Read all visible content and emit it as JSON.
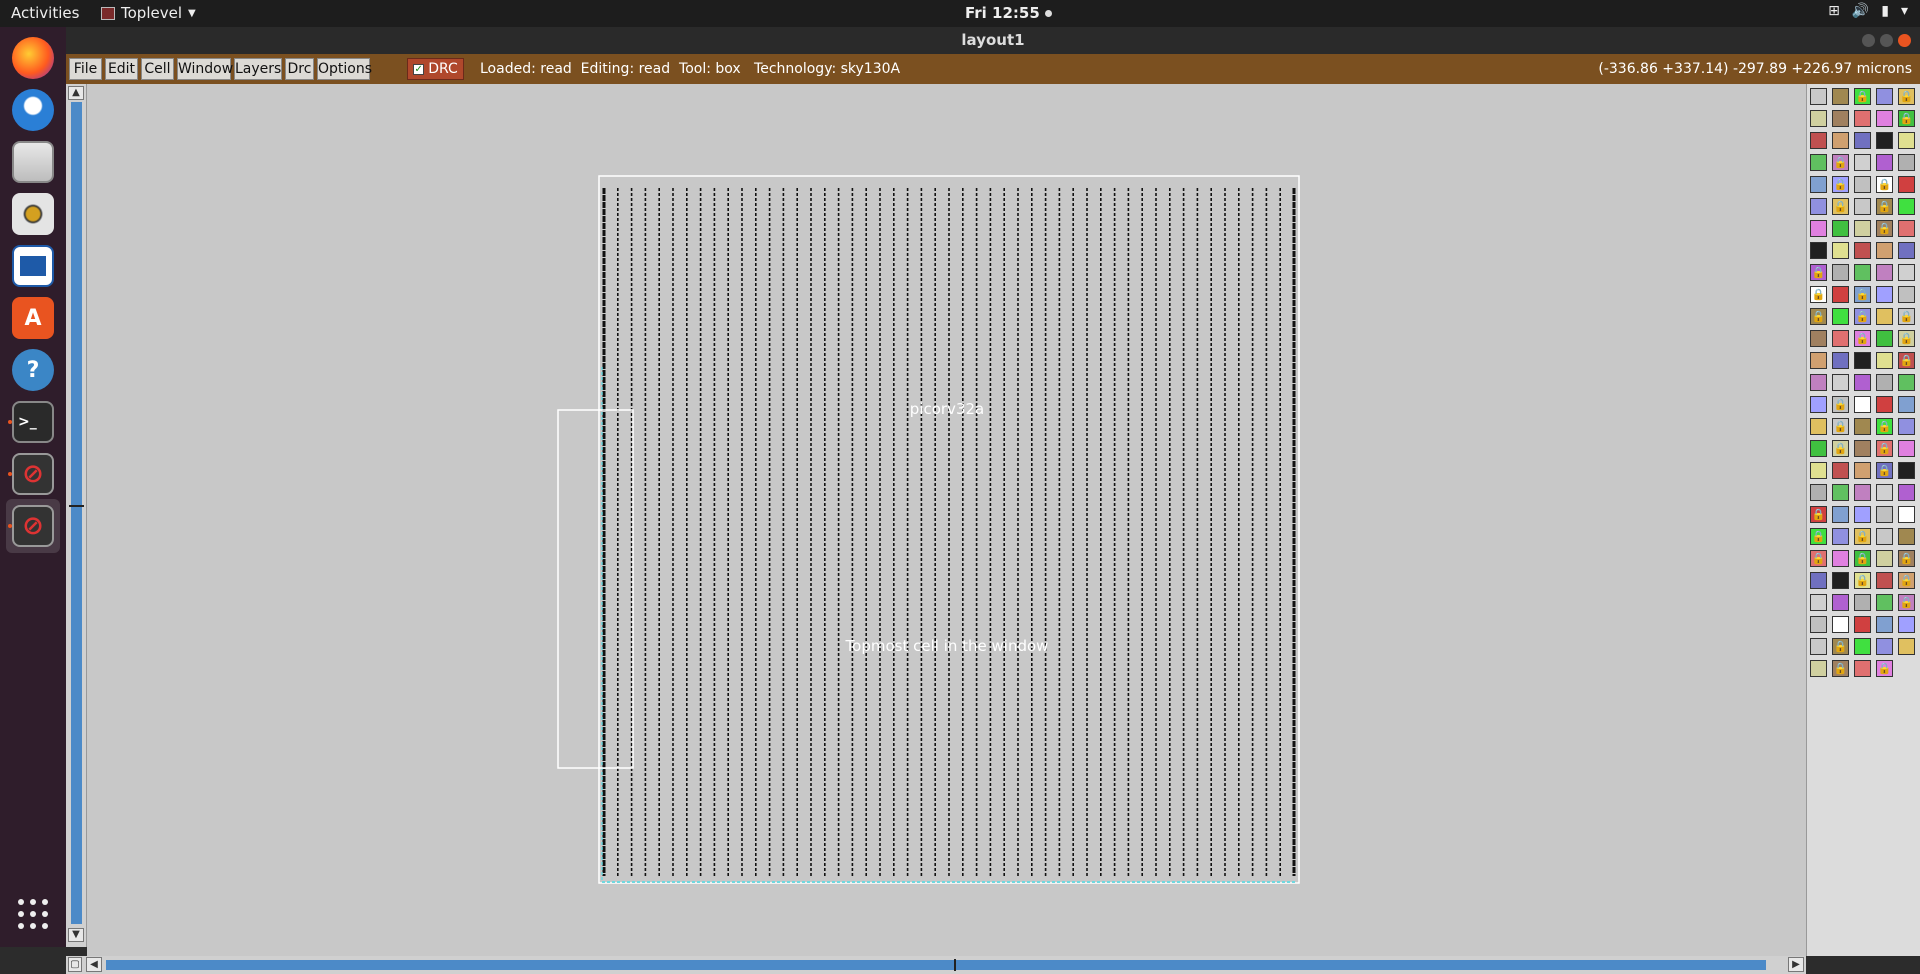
{
  "topbar": {
    "activities": "Activities",
    "app_menu": "Toplevel",
    "clock": "Fri 12:55"
  },
  "window": {
    "title": "layout1"
  },
  "menubar": {
    "file": "File",
    "edit": "Edit",
    "cell": "Cell",
    "window": "Window",
    "layers": "Layers",
    "drc": "Drc",
    "options": "Options",
    "drc_toggle": "DRC",
    "status": "Loaded: read  Editing: read  Tool: box   Technology: sky130A",
    "coords": "(-336.86 +337.14) -297.89 +226.97 microns"
  },
  "canvas": {
    "cell_name": "picorv32a",
    "topmost_label": "Topmost cell in the window"
  },
  "dock": {
    "items": [
      "firefox-icon",
      "thunderbird-icon",
      "files-icon",
      "rhythmbox-icon",
      "writer-icon",
      "software-icon",
      "help-icon",
      "terminal-icon",
      "magic-icon",
      "magic-icon"
    ]
  },
  "colors": {
    "menubar_bg": "#7b5020",
    "drc_button": "#b0482c",
    "canvas_bg": "#c8c8c8",
    "scroll_blue": "#4c8ac8",
    "dock_bg": "#2f1d2b"
  }
}
